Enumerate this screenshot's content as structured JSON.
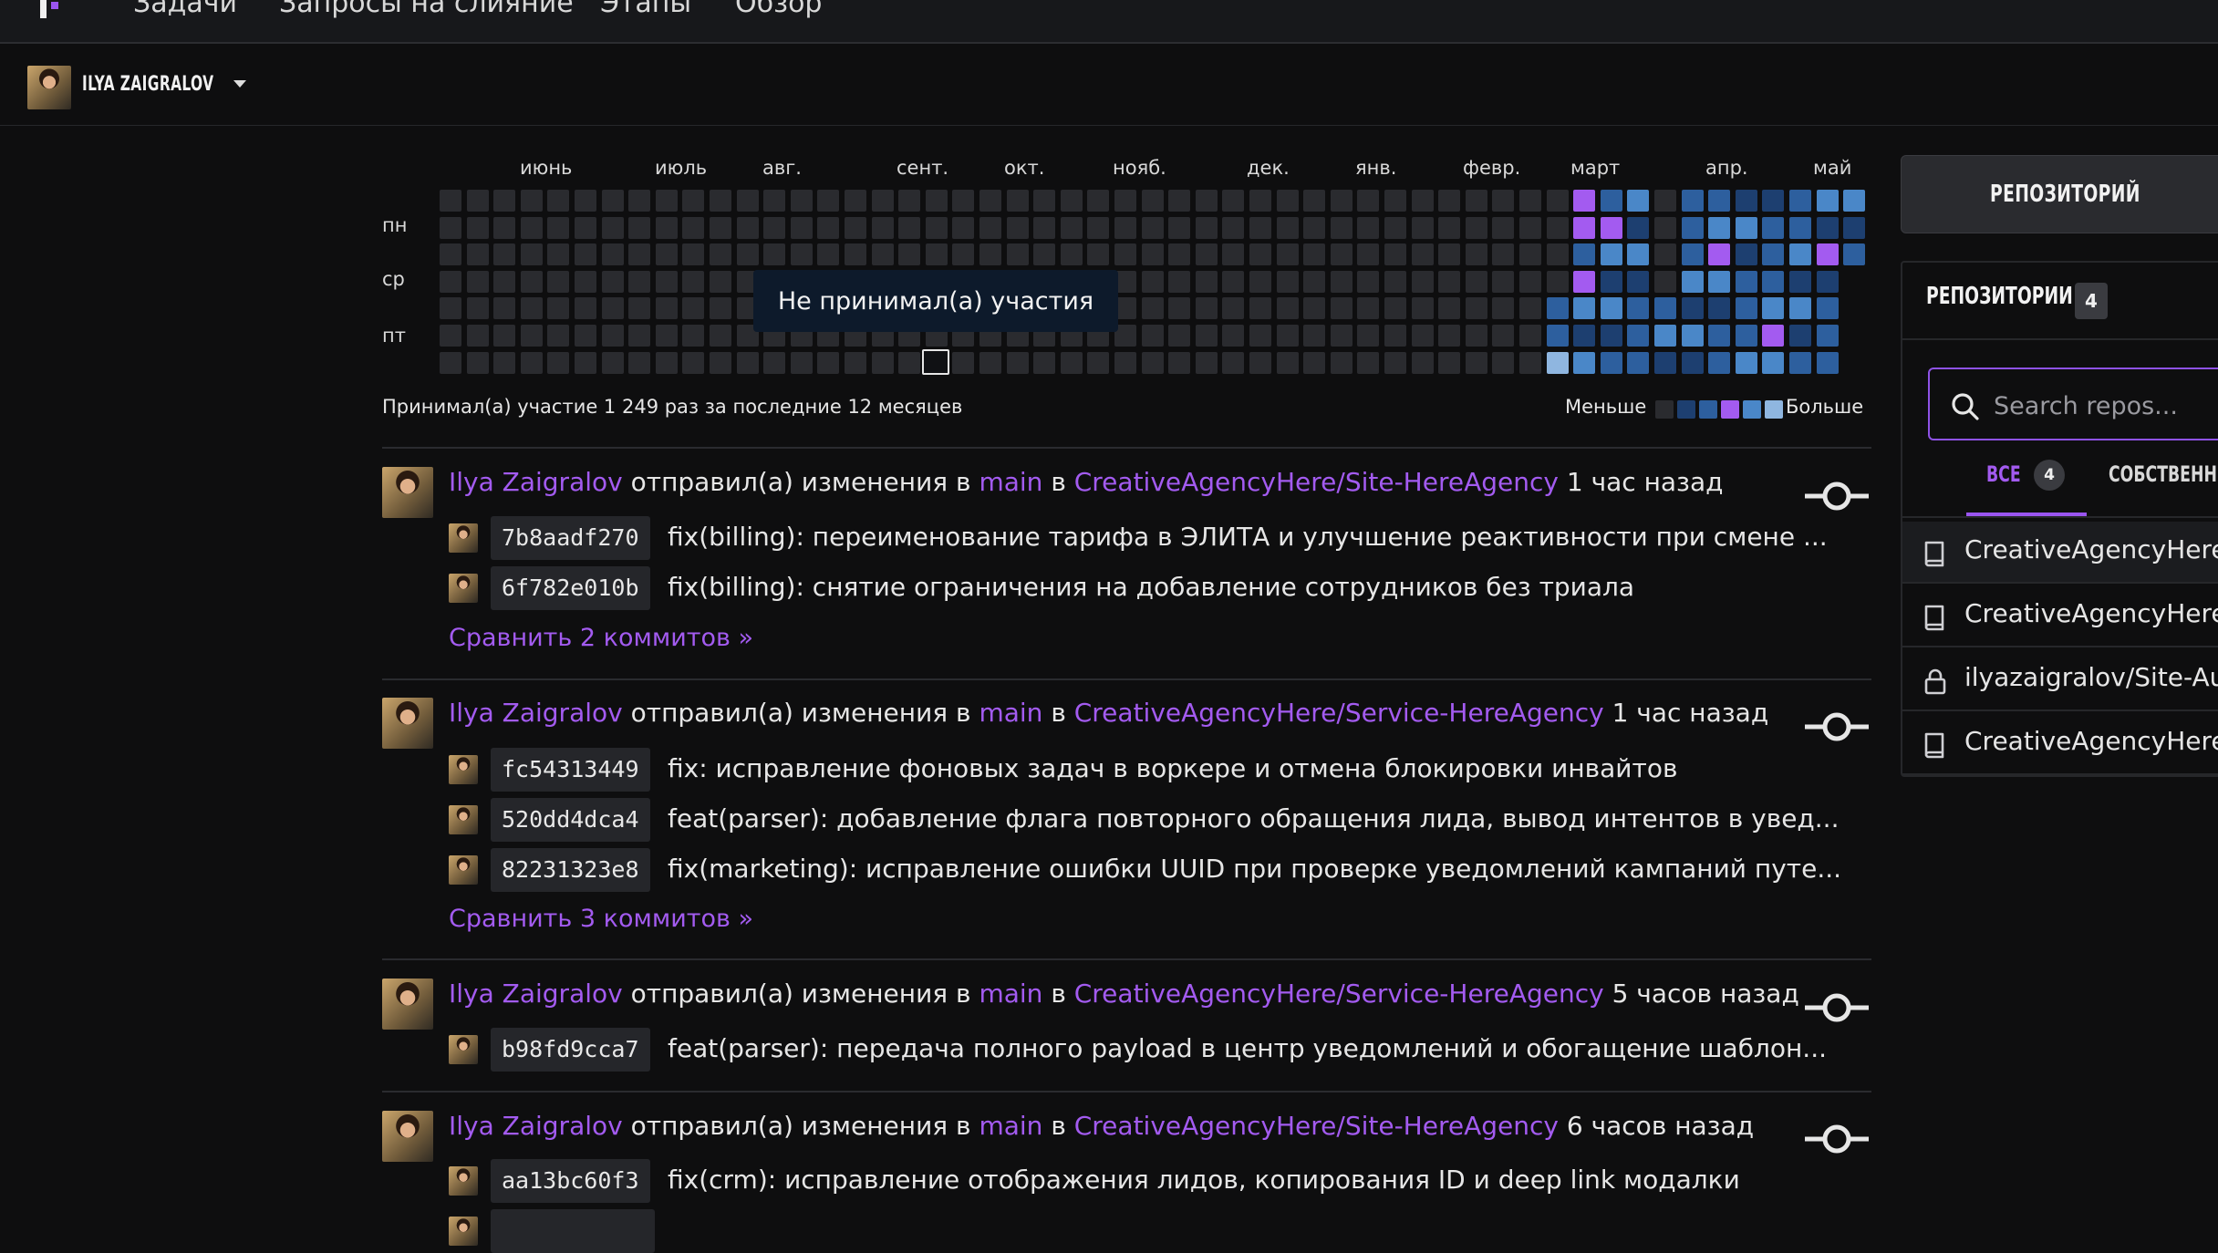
{
  "nav": {
    "items": [
      "Задачи",
      "Запросы на слияние",
      "Этапы",
      "Обзор"
    ]
  },
  "user": {
    "name": "ILYA ZAIGRALOV"
  },
  "heatmap": {
    "months": [
      "июнь",
      "июль",
      "авг.",
      "сент.",
      "окт.",
      "нояб.",
      "дек.",
      "янв.",
      "февр.",
      "март",
      "апр.",
      "май"
    ],
    "day_labels": [
      "пн",
      "ср",
      "пт"
    ],
    "tooltip": "Не принимал(а) участия",
    "summary": "Принимал(а) участие 1 249 раз за последние 12 месяцев",
    "legend_less": "Меньше",
    "legend_more": "Больше",
    "colors": {
      "empty": "#2a2b2f",
      "l1": "#1d3f70",
      "l2": "#2d5f9e",
      "l3": "#4a87c8",
      "l4": "#a35bf0",
      "l5": "#8fb6e0"
    }
  },
  "feed": [
    {
      "author": "Ilya Zaigralov",
      "action": "отправил(а) изменения в",
      "branch": "main",
      "in": "в",
      "repo": "CreativeAgencyHere/Site-HereAgency",
      "time": "1 час назад",
      "commits": [
        {
          "sha": "7b8aadf270",
          "msg": "fix(billing): переименование тарифа в ЭЛИТА и улучшение реактивности при смене ..."
        },
        {
          "sha": "6f782e010b",
          "msg": "fix(billing): снятие ограничения на добавление сотрудников без триала"
        }
      ],
      "compare": "Сравнить 2 коммитов »"
    },
    {
      "author": "Ilya Zaigralov",
      "action": "отправил(а) изменения в",
      "branch": "main",
      "in": "в",
      "repo": "CreativeAgencyHere/Service-HereAgency",
      "time": "1 час назад",
      "commits": [
        {
          "sha": "fc54313449",
          "msg": "fix: исправление фоновых задач в воркере и отмена блокировки инвайтов"
        },
        {
          "sha": "520dd4dca4",
          "msg": "feat(parser): добавление флага повторного обращения лида, вывод интентов в увед..."
        },
        {
          "sha": "82231323e8",
          "msg": "fix(marketing): исправление ошибки UUID при проверке уведомлений кампаний путе..."
        }
      ],
      "compare": "Сравнить 3 коммитов »"
    },
    {
      "author": "Ilya Zaigralov",
      "action": "отправил(а) изменения в",
      "branch": "main",
      "in": "в",
      "repo": "CreativeAgencyHere/Service-HereAgency",
      "time": "5 часов назад",
      "commits": [
        {
          "sha": "b98fd9cca7",
          "msg": "feat(parser): передача полного payload в центр уведомлений и обогащение шаблон..."
        }
      ]
    },
    {
      "author": "Ilya Zaigralov",
      "action": "отправил(а) изменения в",
      "branch": "main",
      "in": "в",
      "repo": "CreativeAgencyHere/Site-HereAgency",
      "time": "6 часов назад",
      "commits": [
        {
          "sha": "aa13bc60f3",
          "msg": "fix(crm): исправление отображения лидов, копирования ID и deep link модалки"
        }
      ]
    }
  ],
  "sidebar": {
    "repo_button": "РЕПОЗИТОРИЙ",
    "repos_title": "РЕПОЗИТОРИИ",
    "repos_count": "4",
    "search_placeholder": "Search repos...",
    "tab_all": "ВСЕ",
    "tab_all_count": "4",
    "tab_own": "СОБСТВЕННЫЕ",
    "repos": [
      {
        "name": "CreativeAgencyHere/Site-HereAgency",
        "icon": "repo-icon"
      },
      {
        "name": "CreativeAgencyHere/Service-HereAgency",
        "icon": "repo-icon"
      },
      {
        "name": "ilyazaigralov/Site-Auto",
        "icon": "lock-icon"
      },
      {
        "name": "CreativeAgencyHere/Mobile-HereAgency",
        "icon": "repo-icon"
      }
    ]
  }
}
